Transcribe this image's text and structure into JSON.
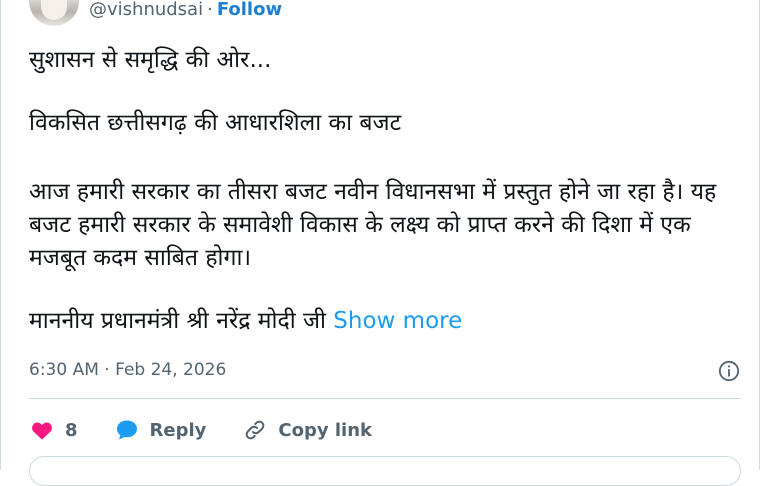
{
  "header": {
    "handle": "@vishnudsai",
    "separator": "·",
    "follow_label": "Follow"
  },
  "tweet": {
    "line1": "सुशासन से समृद्धि की ओर...",
    "line2": "विकसित छत्तीसगढ़ की आधारशिला का बजट",
    "line3": "आज हमारी सरकार का तीसरा बजट नवीन विधानसभा में प्रस्तुत होने जा रहा है। यह बजट हमारी सरकार के समावेशी विकास के लक्ष्य को प्राप्त करने की दिशा में एक मजबूत कदम साबित होगा।",
    "line4": "माननीय प्रधानमंत्री श्री नरेंद्र मोदी जी",
    "show_more": "Show more"
  },
  "meta": {
    "time": "6:30 AM",
    "separator": "·",
    "date": "Feb 24, 2026"
  },
  "actions": {
    "like_count": "8",
    "reply_label": "Reply",
    "copy_label": "Copy link"
  },
  "colors": {
    "accent": "#1d9bf0",
    "follow": "#1d7fd1",
    "heart": "#f91880",
    "muted": "#536471"
  }
}
